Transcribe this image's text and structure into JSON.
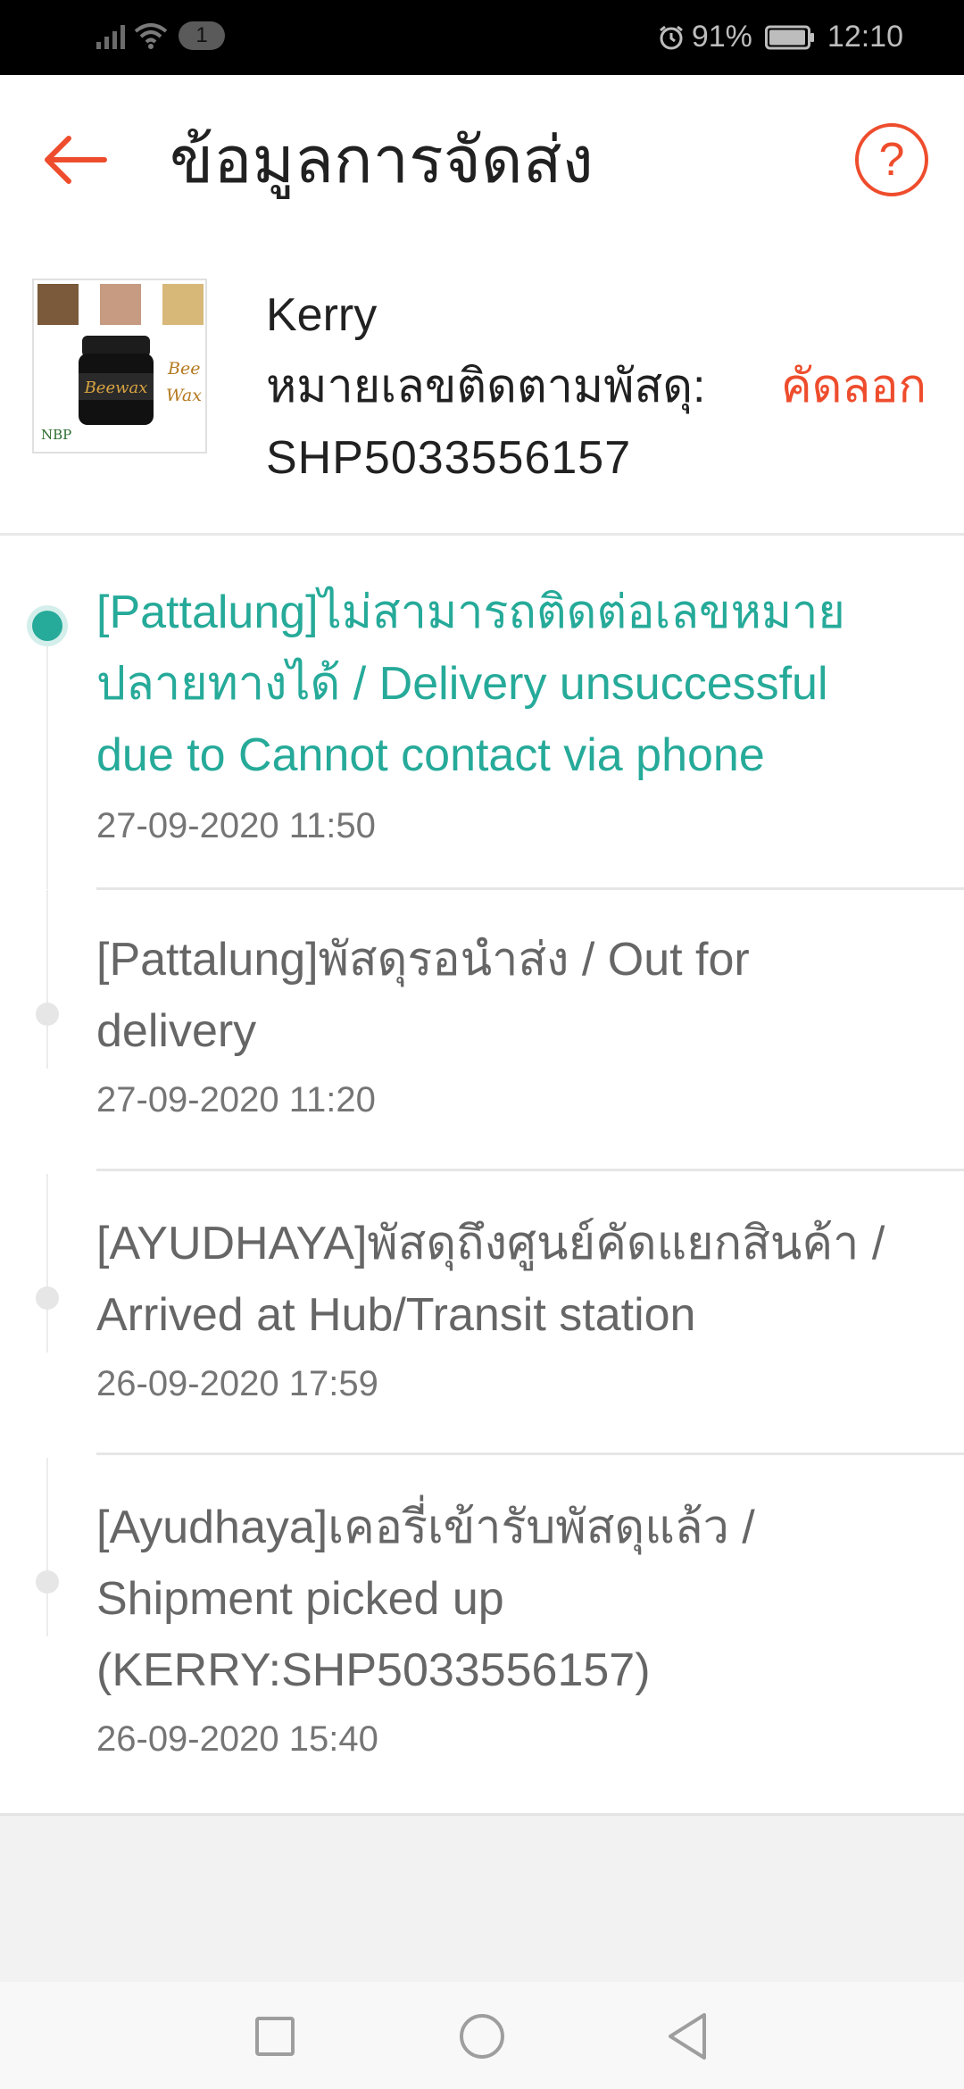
{
  "status_bar": {
    "sim_badge": "1",
    "battery_percent": "91%",
    "time": "12:10",
    "icons": [
      "signal-icon",
      "wifi-icon",
      "alarm-icon",
      "battery-icon"
    ]
  },
  "header": {
    "title": "ข้อมูลการจัดส่ง",
    "back_icon": "arrow-left-icon",
    "help_icon": "question-mark-icon",
    "help_glyph": "?"
  },
  "shipment": {
    "carrier": "Kerry",
    "tracking_label": "หมายเลขติดตามพัสดุ:",
    "copy_label": "คัดลอก",
    "tracking_number": "SHP5033556157",
    "product_image_text": {
      "main": "Beewax",
      "side_top": "Bee",
      "side_bottom": "Wax",
      "corner": "NBP"
    }
  },
  "timeline": {
    "events": [
      {
        "description": "[Pattalung]ไม่สามารถติดต่อเลขหมายปลายทางได้ / Delivery unsuccessful due to Cannot contact via phone",
        "time": "27-09-2020 11:50",
        "active": true
      },
      {
        "description": "[Pattalung]พัสดุรอนำส่ง / Out for delivery",
        "time": "27-09-2020 11:20",
        "active": false
      },
      {
        "description": "[AYUDHAYA]พัสดุถึงศูนย์คัดแยกสินค้า / Arrived at Hub/Transit station",
        "time": "26-09-2020 17:59",
        "active": false
      },
      {
        "description": "[Ayudhaya]เคอรี่เข้ารับพัสดุแล้ว / Shipment picked up (KERRY:SHP5033556157)",
        "time": "26-09-2020 15:40",
        "active": false
      }
    ]
  },
  "nav_bar": {
    "icons": [
      "recent-apps-icon",
      "home-icon",
      "back-icon"
    ]
  },
  "colors": {
    "accent": "#ee4d2d",
    "active_status": "#26aa99",
    "inactive_text": "#666666"
  }
}
